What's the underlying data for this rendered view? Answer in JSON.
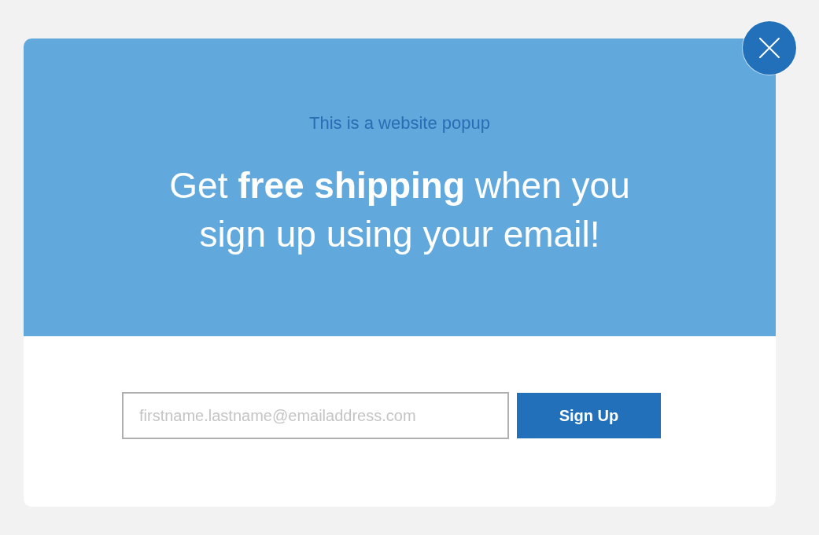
{
  "popup": {
    "subtitle": "This is a website popup",
    "headline": "Get **free shipping** when you sign up using your email!",
    "email_field": {
      "placeholder": "firstname.lastname@emailaddress.com"
    },
    "submit_button": {
      "label": "Sign Up"
    }
  }
}
